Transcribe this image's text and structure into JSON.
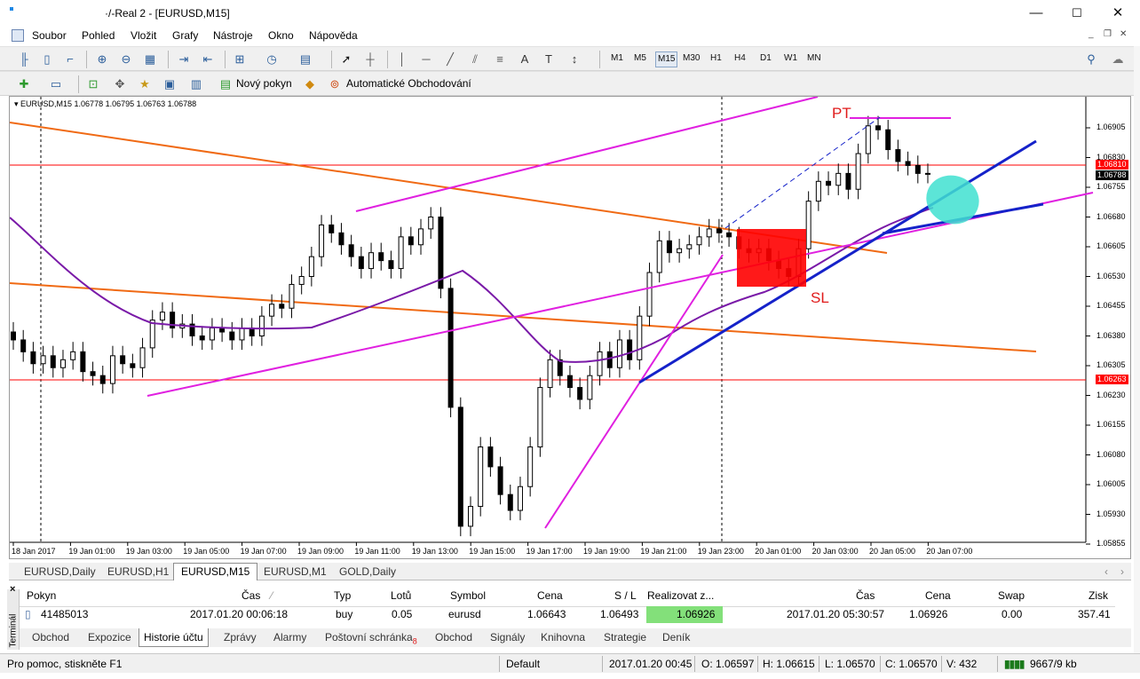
{
  "window": {
    "title": "·/-Real 2 - [EURUSD,M15]",
    "minimize": "—",
    "maximize": "☐",
    "close": "✕"
  },
  "menu": [
    "Soubor",
    "Pohled",
    "Vložit",
    "Grafy",
    "Nástroje",
    "Okno",
    "Nápověda"
  ],
  "timeframes": [
    "M1",
    "M5",
    "M15",
    "M30",
    "H1",
    "H4",
    "D1",
    "W1",
    "MN"
  ],
  "active_timeframe": "M15",
  "toolbar2": {
    "new_order": "Nový pokyn",
    "auto_trading": "Automatické Obchodování"
  },
  "chart": {
    "header": "EURUSD,M15  1.06778 1.06795 1.06763 1.06788",
    "labels": {
      "pt": "PT",
      "sl": "SL"
    },
    "price_tags": {
      "ask": "1.06810",
      "bid": "1.06788",
      "line2": "1.06263"
    },
    "colors": {
      "pt": "#e01b8c",
      "sl": "#e01b1b",
      "magenta": "#e020e0",
      "orange": "#f06a14",
      "blue": "#1522c9",
      "ma": "#7a1aa8",
      "redbox": "#ff0000",
      "cyan": "#40e0d0"
    }
  },
  "chart_data": {
    "type": "candlestick",
    "symbol": "EURUSD",
    "timeframe": "M15",
    "y_ticks": [
      "1.06905",
      "1.06830",
      "1.06755",
      "1.06680",
      "1.06605",
      "1.06530",
      "1.06455",
      "1.06380",
      "1.06305",
      "1.06230",
      "1.06155",
      "1.06080",
      "1.06005",
      "1.05930",
      "1.05855"
    ],
    "x_ticks": [
      "18 Jan 2017",
      "19 Jan 01:00",
      "19 Jan 03:00",
      "19 Jan 05:00",
      "19 Jan 07:00",
      "19 Jan 09:00",
      "19 Jan 11:00",
      "19 Jan 13:00",
      "19 Jan 15:00",
      "19 Jan 17:00",
      "19 Jan 19:00",
      "19 Jan 21:00",
      "19 Jan 23:00",
      "20 Jan 01:00",
      "20 Jan 03:00",
      "20 Jan 05:00",
      "20 Jan 07:00"
    ],
    "ylim": [
      1.05855,
      1.0694
    ],
    "last_ohlc": {
      "open": 1.06778,
      "high": 1.06795,
      "low": 1.06763,
      "close": 1.06788
    },
    "closes": [
      1.0637,
      1.0634,
      1.0631,
      1.0633,
      1.063,
      1.0632,
      1.0634,
      1.0629,
      1.0628,
      1.0626,
      1.0633,
      1.0631,
      1.063,
      1.0635,
      1.0642,
      1.0644,
      1.064,
      1.0641,
      1.0638,
      1.0637,
      1.064,
      1.0639,
      1.0637,
      1.064,
      1.0638,
      1.0643,
      1.0646,
      1.0645,
      1.0651,
      1.0653,
      1.0658,
      1.0666,
      1.0664,
      1.0661,
      1.0658,
      1.0655,
      1.0659,
      1.0657,
      1.0655,
      1.0663,
      1.0661,
      1.0665,
      1.0668,
      1.065,
      1.062,
      1.059,
      1.0595,
      1.061,
      1.0605,
      1.0598,
      1.0594,
      1.06,
      1.061,
      1.0625,
      1.0632,
      1.0628,
      1.0625,
      1.0622,
      1.0628,
      1.0634,
      1.063,
      1.0637,
      1.0632,
      1.0643,
      1.0654,
      1.0662,
      1.0659,
      1.066,
      1.0661,
      1.0663,
      1.0665,
      1.0664,
      1.0663,
      1.066,
      1.0659,
      1.066,
      1.0657,
      1.0655,
      1.0653,
      1.066,
      1.0672,
      1.0677,
      1.0676,
      1.0679,
      1.0675,
      1.0684,
      1.0691,
      1.069,
      1.0685,
      1.0682,
      1.0681,
      1.0679,
      1.0679
    ]
  },
  "chart_tabs": [
    "EURUSD,Daily",
    "EURUSD,H1",
    "EURUSD,M15",
    "EURUSD,M1",
    "GOLD,Daily"
  ],
  "active_chart_tab": "EURUSD,M15",
  "terminal": {
    "side_label": "Terminál",
    "headers": {
      "order": "Pokyn",
      "time": "Čas",
      "type": "Typ",
      "lots": "Lotů",
      "symbol": "Symbol",
      "price": "Cena",
      "sl": "S / L",
      "tp": "Realizovat z...",
      "time2": "Čas",
      "price2": "Cena",
      "swap": "Swap",
      "profit": "Zisk"
    },
    "row": {
      "order": "41485013",
      "time": "2017.01.20 00:06:18",
      "type": "buy",
      "lots": "0.05",
      "symbol": "eurusd",
      "price": "1.06643",
      "sl": "1.06493",
      "tp": "1.06926",
      "time2": "2017.01.20 05:30:57",
      "price2": "1.06926",
      "swap": "0.00",
      "profit": "357.41"
    }
  },
  "bottom_tabs": [
    "Obchod",
    "Expozice",
    "Historie účtu",
    "Zprávy",
    "Alarmy",
    "Poštovní schránka",
    "Obchod",
    "Signály",
    "Knihovna",
    "Strategie",
    "Deník"
  ],
  "mailbox_count": "8",
  "active_bottom_tab": "Historie účtu",
  "status": {
    "help": "Pro pomoc, stiskněte F1",
    "profile": "Default",
    "time": "2017.01.20 00:45",
    "o": "O: 1.06597",
    "h": "H: 1.06615",
    "l": "L: 1.06570",
    "c": "C: 1.06570",
    "v": "V: 432",
    "traffic": "9667/9 kb"
  }
}
